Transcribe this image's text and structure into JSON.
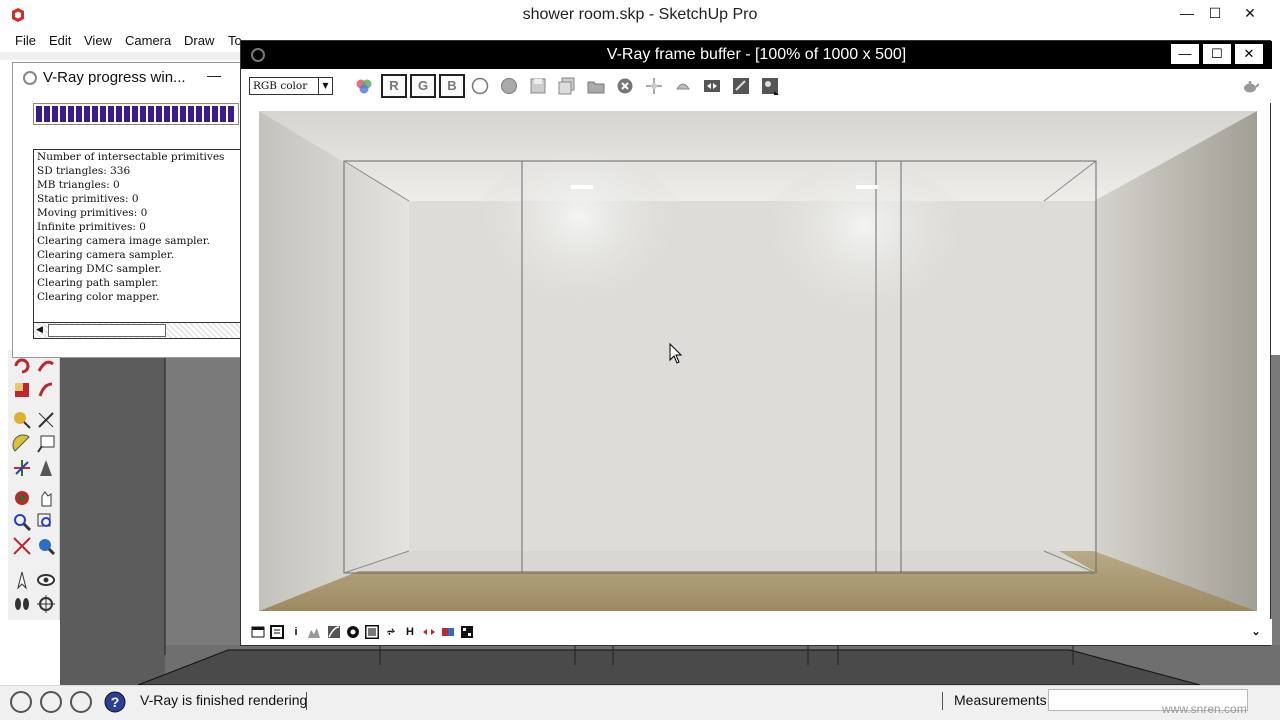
{
  "app": {
    "title": "shower room.skp - SketchUp Pro",
    "window_buttons": [
      "—",
      "☐",
      "✕"
    ]
  },
  "menu": [
    "File",
    "Edit",
    "View",
    "Camera",
    "Draw",
    "To"
  ],
  "progress_window": {
    "title": "V-Ray progress win...",
    "progress_percent": 100,
    "log_lines": [
      "Number of intersectable primitives",
      "SD triangles: 336",
      "MB triangles: 0",
      "Static primitives: 0",
      "Moving primitives: 0",
      "Infinite primitives: 0",
      "Clearing camera image sampler.",
      "Clearing camera sampler.",
      "Clearing DMC sampler.",
      "Clearing path sampler.",
      "Clearing color mapper."
    ]
  },
  "frame_buffer": {
    "title": "V-Ray frame buffer - [100% of 1000 x 500]",
    "channel": "RGB color",
    "channel_buttons": [
      "R",
      "G",
      "B"
    ]
  },
  "status": {
    "message": "V-Ray is finished rendering",
    "measurements_label": "Measurements",
    "watermark": "www.snren.com"
  }
}
